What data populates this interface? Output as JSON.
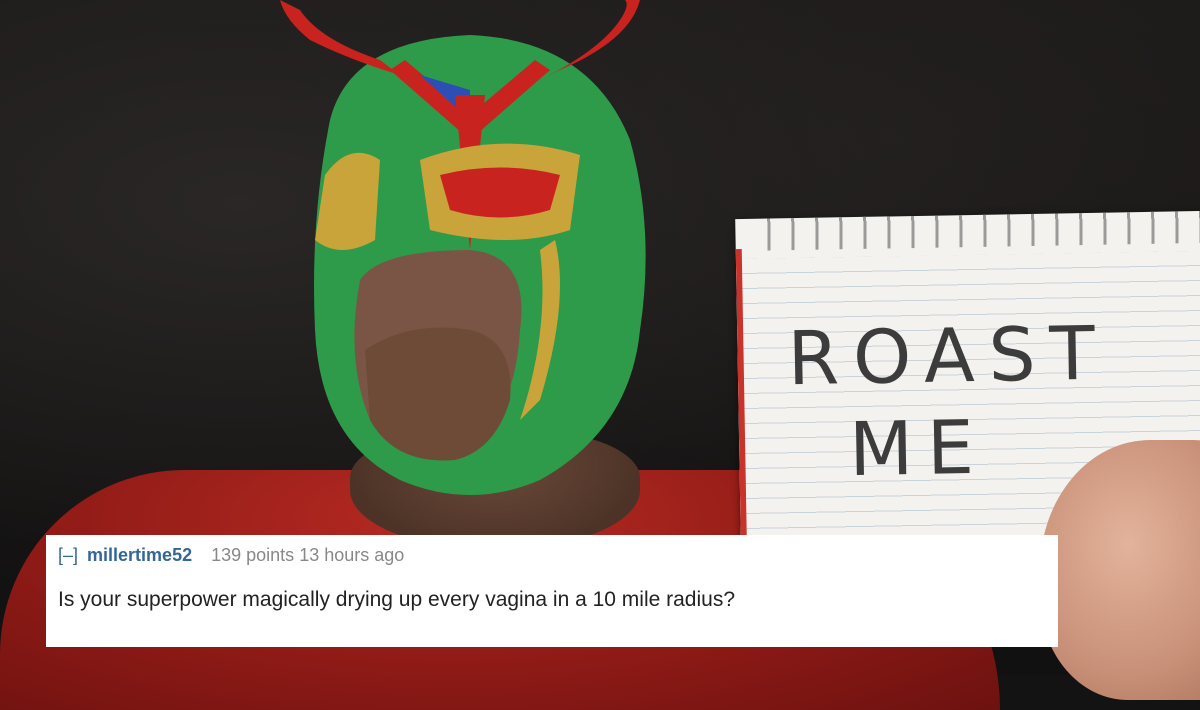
{
  "sign": {
    "line1": "ROAST",
    "line2": "ME"
  },
  "comment": {
    "collapse": "[–]",
    "author": "millertime52",
    "points": "139 points",
    "time": "13 hours ago",
    "text": "Is your superpower magically drying up every vagina in a 10 mile radius?"
  },
  "colors": {
    "mask_green": "#2e9b4a",
    "mask_red": "#c8231f",
    "mask_gold": "#c9a43a",
    "author_blue": "#336699",
    "shirt_red": "#9e1f19"
  }
}
